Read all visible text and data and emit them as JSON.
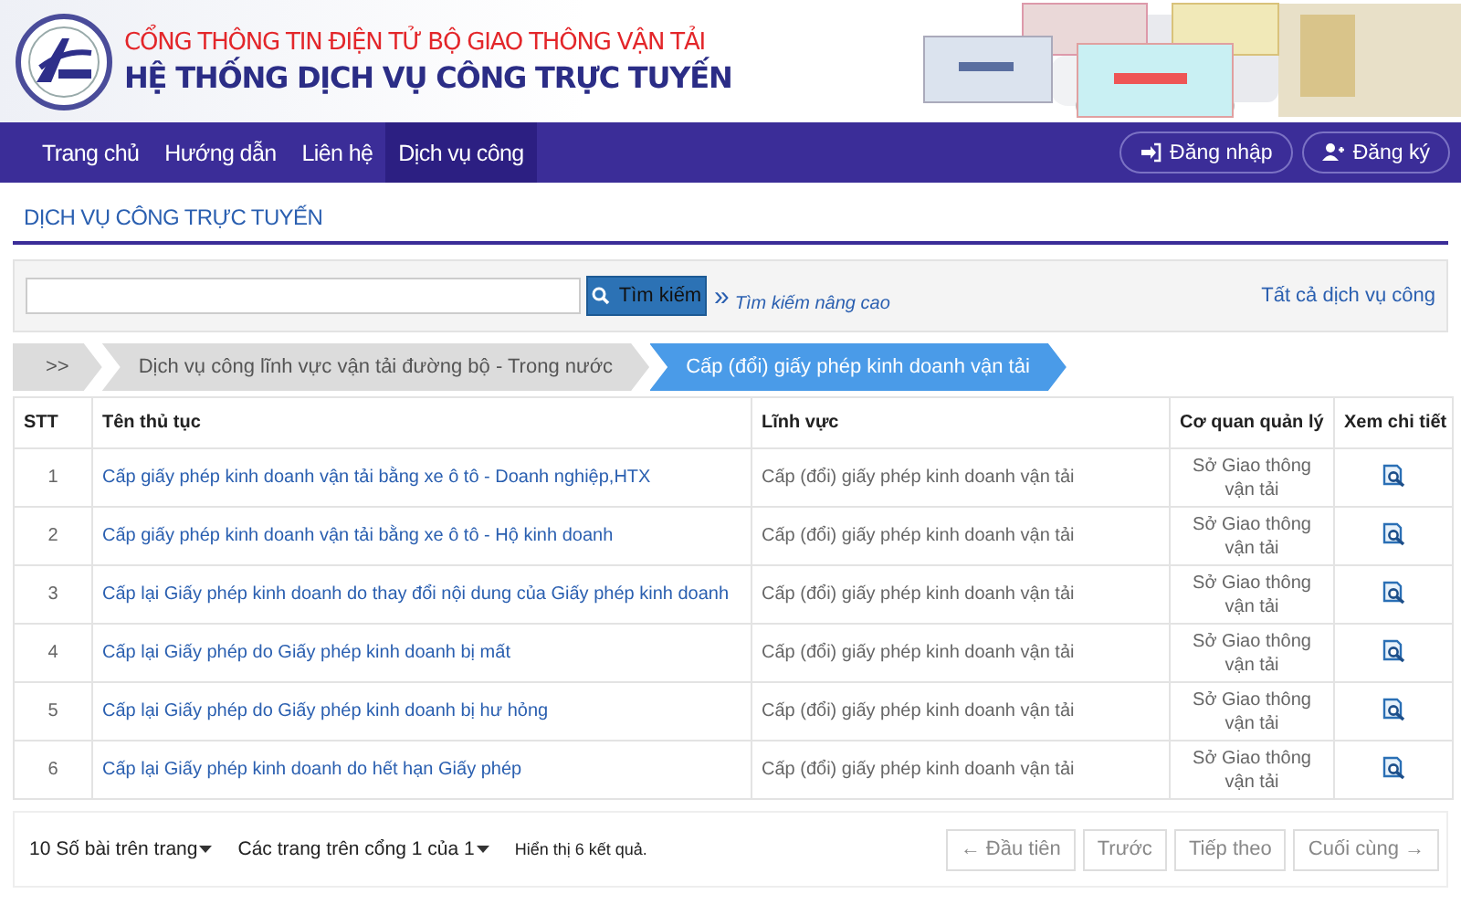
{
  "header": {
    "subtitle": "CỔNG THÔNG TIN ĐIỆN TỬ BỘ GIAO THÔNG VẬN TẢI",
    "title": "HỆ THỐNG DỊCH VỤ CÔNG TRỰC TUYẾN"
  },
  "nav": {
    "items": [
      {
        "label": "Trang chủ",
        "selected": false
      },
      {
        "label": "Hướng dẫn",
        "selected": false
      },
      {
        "label": "Liên hệ",
        "selected": false
      },
      {
        "label": "Dịch vụ công",
        "selected": true
      }
    ],
    "buttons": [
      {
        "label": "Đăng nhập",
        "kind": "login"
      },
      {
        "label": "Đăng ký",
        "kind": "register"
      }
    ]
  },
  "section_title": "DỊCH VỤ CÔNG TRỰC TUYẾN",
  "search": {
    "button": "Tìm kiếm",
    "advanced_mark": "»",
    "advanced": "Tìm kiếm nâng cao",
    "all_services": "Tất cả dịch vụ công"
  },
  "breadcrumb": [
    {
      "label": ">>",
      "selected": false
    },
    {
      "label": "Dịch vụ công lĩnh vực vận tải đường bộ - Trong nước",
      "selected": false
    },
    {
      "label": "Cấp (đổi) giấy phép kinh doanh vận tải",
      "selected": true
    }
  ],
  "table": {
    "columns": [
      "STT",
      "Tên thủ tục",
      "Lĩnh vực",
      "Cơ quan quản lý",
      "Xem chi tiết"
    ],
    "rows": [
      {
        "stt": "1",
        "name": "Cấp giấy phép kinh doanh vận tải bằng xe ô tô - Doanh nghiệp,HTX",
        "field": "Cấp (đổi) giấy phép kinh doanh vận tải",
        "agency": "Sở Giao thông vận tải"
      },
      {
        "stt": "2",
        "name": "Cấp giấy phép kinh doanh vận tải bằng xe ô tô - Hộ kinh doanh",
        "field": "Cấp (đổi) giấy phép kinh doanh vận tải",
        "agency": "Sở Giao thông vận tải"
      },
      {
        "stt": "3",
        "name": "Cấp lại Giấy phép kinh doanh do thay đổi nội dung của Giấy phép kinh doanh",
        "field": "Cấp (đổi) giấy phép kinh doanh vận tải",
        "agency": "Sở Giao thông vận tải"
      },
      {
        "stt": "4",
        "name": "Cấp lại Giấy phép do Giấy phép kinh doanh bị mất",
        "field": "Cấp (đổi) giấy phép kinh doanh vận tải",
        "agency": "Sở Giao thông vận tải"
      },
      {
        "stt": "5",
        "name": "Cấp lại Giấy phép do Giấy phép kinh doanh bị hư hỏng",
        "field": "Cấp (đổi) giấy phép kinh doanh vận tải",
        "agency": "Sở Giao thông vận tải"
      },
      {
        "stt": "6",
        "name": "Cấp lại Giấy phép kinh doanh do hết hạn Giấy phép",
        "field": "Cấp (đổi) giấy phép kinh doanh vận tải",
        "agency": "Sở Giao thông vận tải"
      }
    ]
  },
  "footer": {
    "page_size": "10 Số bài trên trang",
    "page_select": "Các trang trên cổng 1 của 1",
    "summary": "Hiển thị 6 kết quả.",
    "pager": [
      "← Đầu tiên",
      "Trước",
      "Tiếp theo",
      "Cuối cùng →"
    ]
  }
}
